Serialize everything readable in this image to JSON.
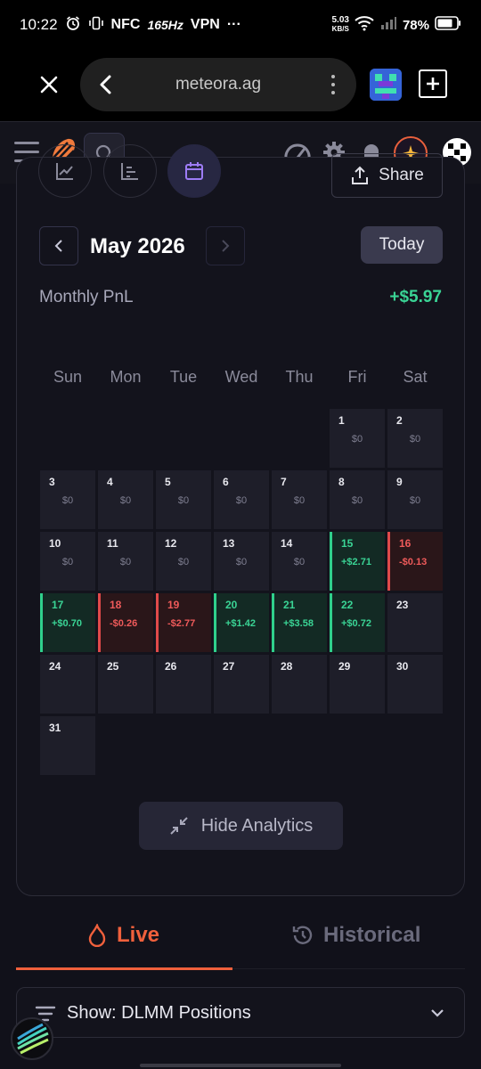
{
  "status_bar": {
    "time": "10:22",
    "nfc": "NFC",
    "refresh_rate": "165Hz",
    "vpn": "VPN",
    "more": "···",
    "net_speed_value": "5.03",
    "net_speed_unit": "KB/S",
    "battery": "78%"
  },
  "browser": {
    "url": "meteora.ag"
  },
  "toolbar": {
    "share_label": "Share"
  },
  "calendar": {
    "month_label": "May 2026",
    "today_label": "Today",
    "monthly_pnl_label": "Monthly PnL",
    "monthly_pnl_value": "+$5.97",
    "weekdays": [
      "Sun",
      "Mon",
      "Tue",
      "Wed",
      "Thu",
      "Fri",
      "Sat"
    ],
    "days": [
      {
        "day": "1",
        "value": "$0",
        "status": "zero"
      },
      {
        "day": "2",
        "value": "$0",
        "status": "zero"
      },
      {
        "day": "3",
        "value": "$0",
        "status": "zero"
      },
      {
        "day": "4",
        "value": "$0",
        "status": "zero"
      },
      {
        "day": "5",
        "value": "$0",
        "status": "zero"
      },
      {
        "day": "6",
        "value": "$0",
        "status": "zero"
      },
      {
        "day": "7",
        "value": "$0",
        "status": "zero"
      },
      {
        "day": "8",
        "value": "$0",
        "status": "zero"
      },
      {
        "day": "9",
        "value": "$0",
        "status": "zero"
      },
      {
        "day": "10",
        "value": "$0",
        "status": "zero"
      },
      {
        "day": "11",
        "value": "$0",
        "status": "zero"
      },
      {
        "day": "12",
        "value": "$0",
        "status": "zero"
      },
      {
        "day": "13",
        "value": "$0",
        "status": "zero"
      },
      {
        "day": "14",
        "value": "$0",
        "status": "zero"
      },
      {
        "day": "15",
        "value": "+$2.71",
        "status": "pos"
      },
      {
        "day": "16",
        "value": "-$0.13",
        "status": "neg"
      },
      {
        "day": "17",
        "value": "+$0.70",
        "status": "pos"
      },
      {
        "day": "18",
        "value": "-$0.26",
        "status": "neg"
      },
      {
        "day": "19",
        "value": "-$2.77",
        "status": "neg"
      },
      {
        "day": "20",
        "value": "+$1.42",
        "status": "pos"
      },
      {
        "day": "21",
        "value": "+$3.58",
        "status": "pos"
      },
      {
        "day": "22",
        "value": "+$0.72",
        "status": "pos"
      },
      {
        "day": "23",
        "value": "",
        "status": "empty"
      },
      {
        "day": "24",
        "value": "",
        "status": "empty"
      },
      {
        "day": "25",
        "value": "",
        "status": "empty"
      },
      {
        "day": "26",
        "value": "",
        "status": "empty"
      },
      {
        "day": "27",
        "value": "",
        "status": "empty"
      },
      {
        "day": "28",
        "value": "",
        "status": "empty"
      },
      {
        "day": "29",
        "value": "",
        "status": "empty"
      },
      {
        "day": "30",
        "value": "",
        "status": "empty"
      },
      {
        "day": "31",
        "value": "",
        "status": "empty"
      }
    ]
  },
  "analytics": {
    "hide_label": "Hide Analytics"
  },
  "tabs": {
    "live_label": "Live",
    "historical_label": "Historical"
  },
  "filter": {
    "show_label": "Show: DLMM Positions"
  },
  "colors": {
    "accent_orange": "#f0603c",
    "positive": "#3ad495",
    "negative": "#ef5a5a"
  }
}
